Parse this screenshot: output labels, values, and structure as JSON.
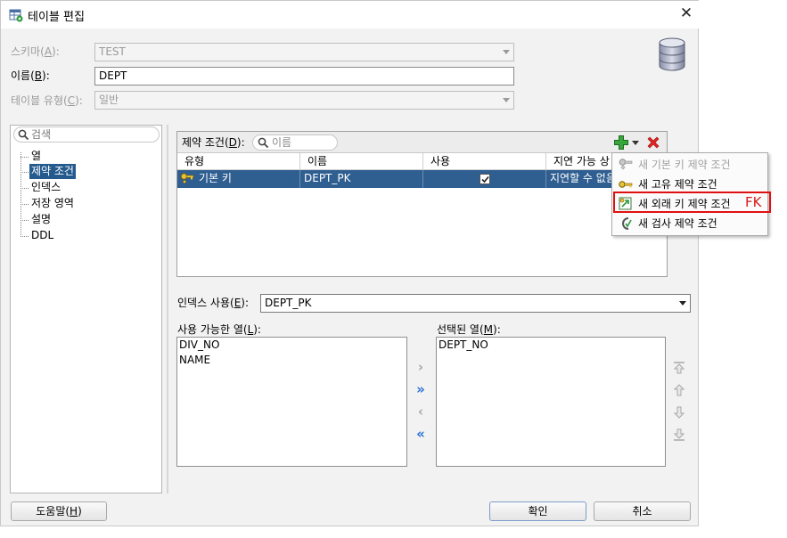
{
  "window": {
    "title": "테이블 편집"
  },
  "form": {
    "schema_label": "스키마",
    "schema_key": "A",
    "schema_value": "TEST",
    "name_label": "이름",
    "name_key": "B",
    "name_value": "DEPT",
    "table_type_label": "테이블 유형",
    "table_type_key": "C",
    "table_type_value": "일반"
  },
  "sidebar": {
    "search_placeholder": "검색",
    "items": [
      {
        "label": "열"
      },
      {
        "label": "제약 조건",
        "selected": true
      },
      {
        "label": "인덱스"
      },
      {
        "label": "저장 영역"
      },
      {
        "label": "설명"
      },
      {
        "label": "DDL"
      }
    ]
  },
  "constraints": {
    "label": "제약 조건",
    "key": "D",
    "search_placeholder": "이름",
    "columns": [
      "유형",
      "이름",
      "사용",
      "지연 가능 상"
    ],
    "rows": [
      {
        "type": "기본 키",
        "name": "DEPT_PK",
        "enabled": true,
        "deferrable": "지연할 수 없음"
      }
    ]
  },
  "add_menu": {
    "items": [
      {
        "label": "새 기본 키 제약 조건",
        "disabled": true,
        "icon": "primary-key-icon"
      },
      {
        "label": "새 고유 제약 조건",
        "disabled": false,
        "icon": "unique-key-icon"
      },
      {
        "label": "새 외래 키 제약 조건",
        "disabled": false,
        "icon": "foreign-key-icon"
      },
      {
        "label": "새 검사 제약 조건",
        "disabled": false,
        "icon": "check-constraint-icon"
      }
    ],
    "annotation": "FK"
  },
  "index": {
    "label": "인덱스 사용",
    "key": "E",
    "value": "DEPT_PK"
  },
  "available": {
    "label": "사용 가능한 열",
    "key": "L",
    "items": [
      "DIV_NO",
      "NAME"
    ]
  },
  "selected": {
    "label": "선택된 열",
    "key": "M",
    "items": [
      "DEPT_NO"
    ]
  },
  "footer": {
    "help_label": "도움말",
    "help_key": "H",
    "ok_label": "확인",
    "cancel_label": "취소"
  },
  "colors": {
    "selection": "#2f5e91",
    "highlight": "#e01010",
    "shuttle_active": "#2a6fd6"
  }
}
